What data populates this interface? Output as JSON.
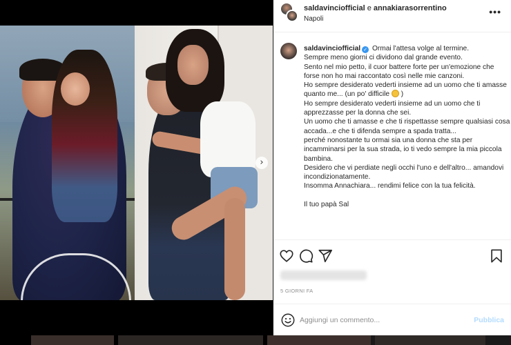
{
  "header": {
    "user1": "saldavincіofficial",
    "joiner": "e",
    "user2": "annakiarasorrentino",
    "location": "Napoli"
  },
  "caption": {
    "username": "saldavincіofficial",
    "lines": [
      "Ormai l'attesa volge al termine.",
      "Sempre meno giorni ci dividono dal grande evento.",
      "Sento nel mio petto, il cuor battere forte per un'emozione che",
      "forse non ho mai raccontato così nelle mie canzoni.",
      "Ho sempre desiderato vederti insieme ad un uomo che ti amasse",
      "quanto me... (un po' difficile",
      ")",
      "Ho sempre desiderato vederti insieme ad un uomo che ti",
      "apprezzasse per la donna che sei.",
      "Un uomo che ti amasse e che ti rispettasse sempre qualsiasi cosa",
      "accada...e che ti difenda sempre a spada tratta...",
      "perché nonostante tu ormai sia una donna che sta per",
      "incamminarsi per la sua strada, io ti vedo sempre la mia piccola",
      "bambina.",
      "Desidero che vi perdiate negli occhi l'uno e dell'altro... amandovi",
      "incondizionatamente.",
      "Insomma Annachiara... rendimi felice con la tua felicità."
    ],
    "signature": "Il tuo papà Sal"
  },
  "post": {
    "time": "5 GIORNI FA"
  },
  "comment": {
    "placeholder": "Aggiungi un commento...",
    "publish": "Pubblica"
  },
  "colors": {
    "verified": "#3897f0",
    "publish": "#b3dbff",
    "text": "#262626",
    "muted": "#8e8e8e"
  },
  "icons": [
    "heart-icon",
    "comment-icon",
    "share-icon",
    "bookmark-icon",
    "smiley-icon",
    "more-icon",
    "carousel-next-icon"
  ]
}
